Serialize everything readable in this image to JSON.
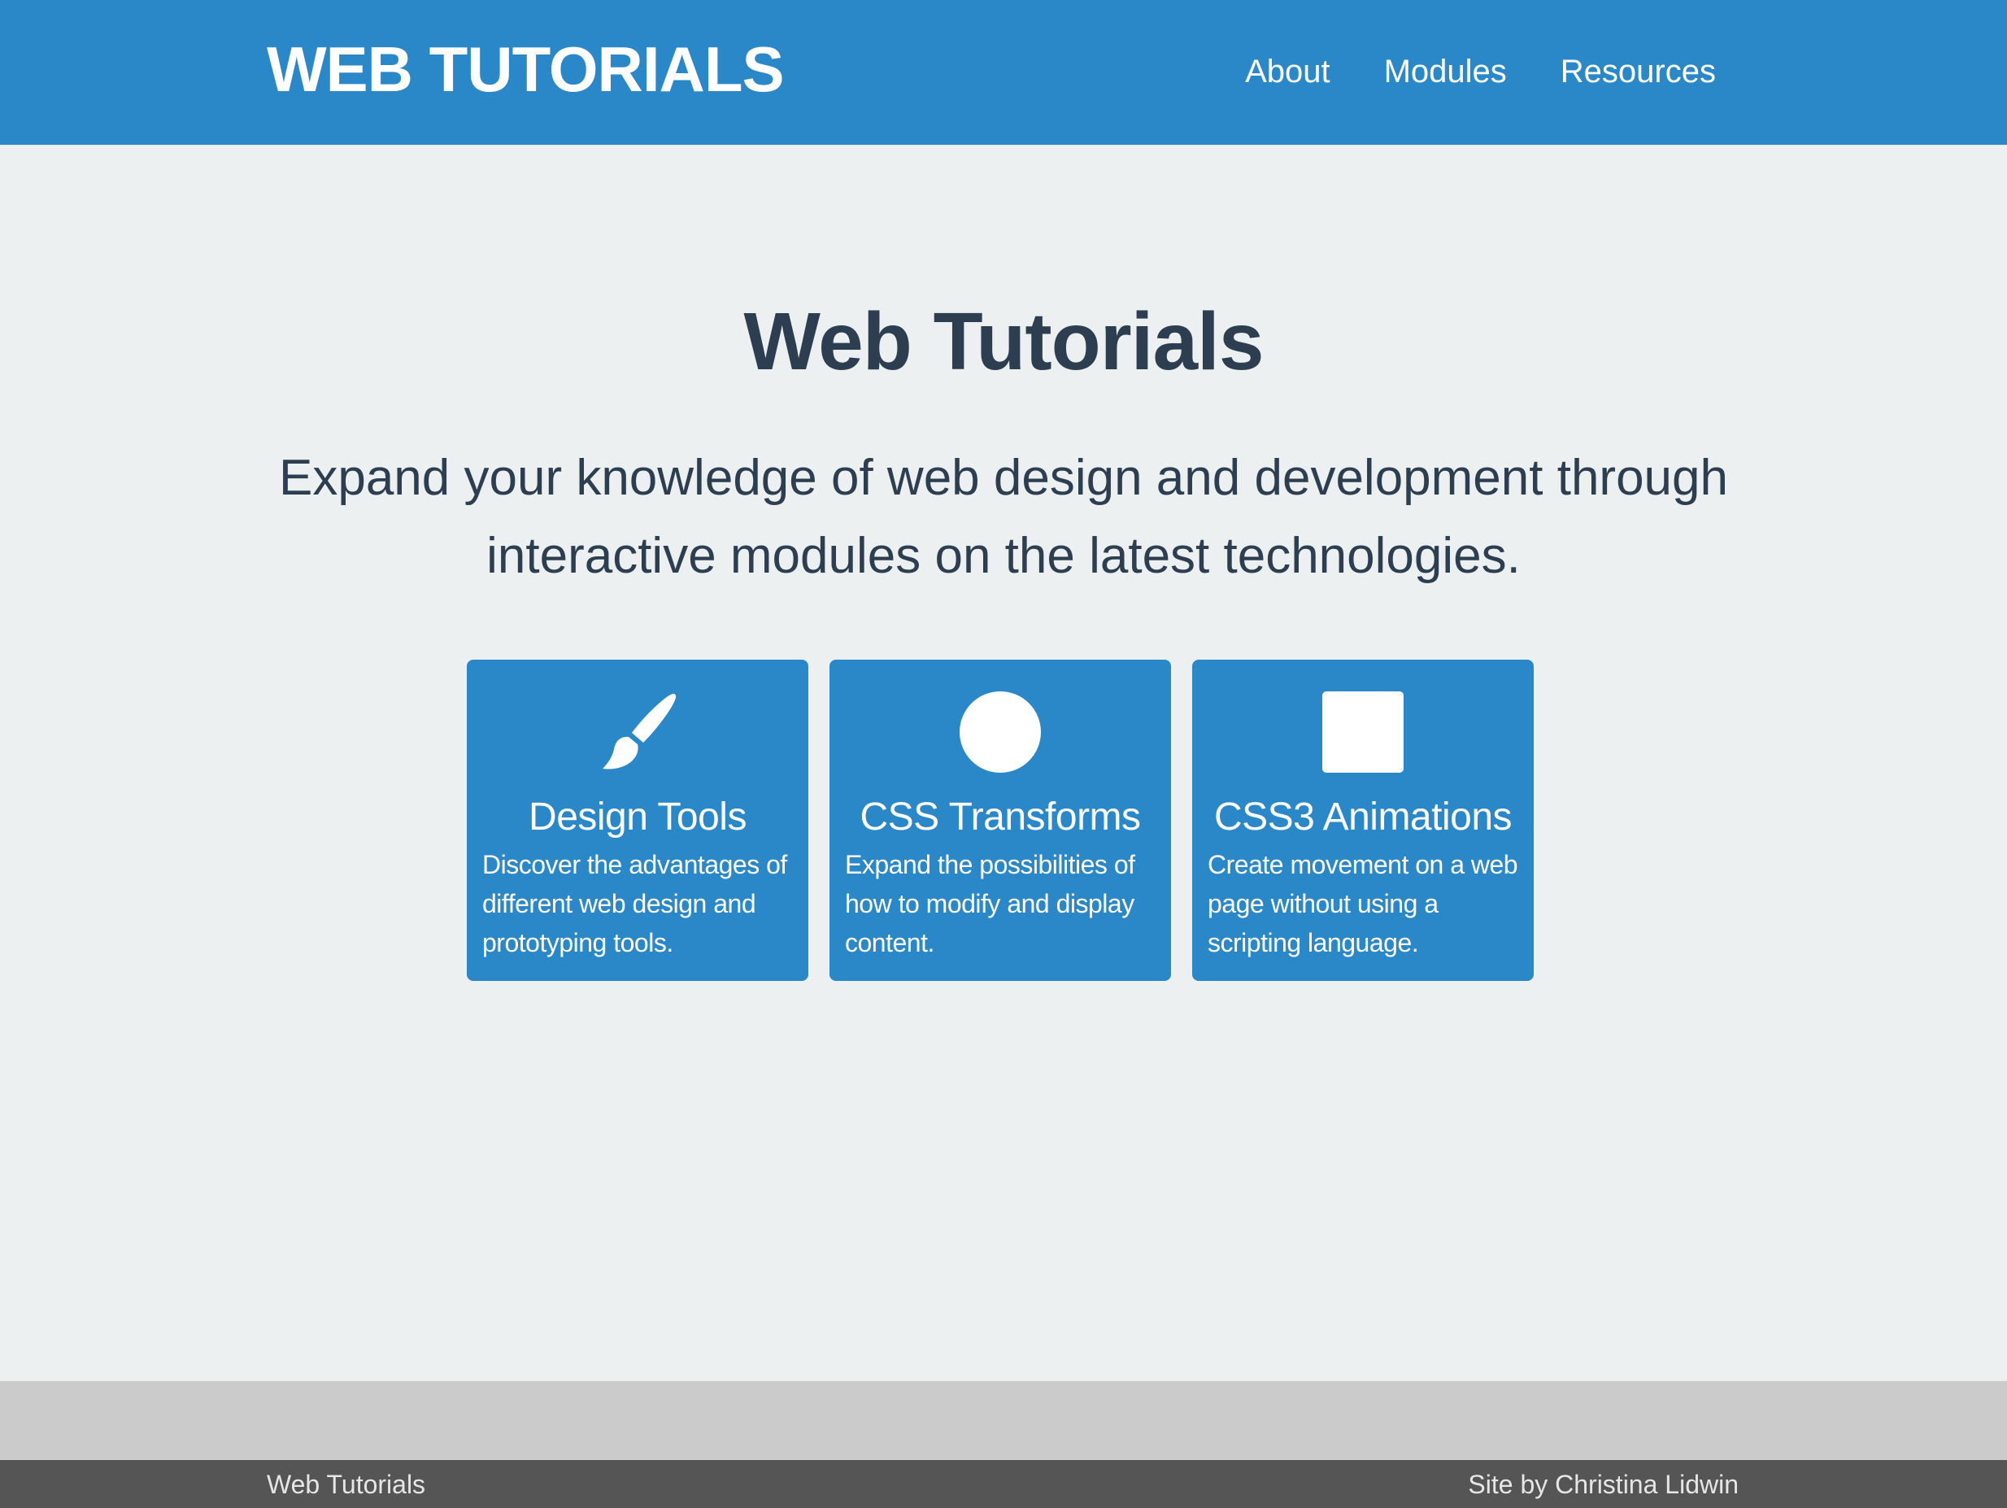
{
  "header": {
    "site_title": "WEB TUTORIALS",
    "nav": [
      {
        "label": "About"
      },
      {
        "label": "Modules"
      },
      {
        "label": "Resources"
      }
    ]
  },
  "hero": {
    "title": "Web Tutorials",
    "subtitle": "Expand your knowledge of web design and development through interactive modules on the latest technologies."
  },
  "cards": [
    {
      "icon": "paintbrush-icon",
      "title": "Design Tools",
      "description": "Discover the advantages of different web design and prototyping tools."
    },
    {
      "icon": "circle-icon",
      "title": "CSS Transforms",
      "description": "Expand the possibilities of how to modify and display content."
    },
    {
      "icon": "square-icon",
      "title": "CSS3 Animations",
      "description": "Create movement on a web page without using a scripting language."
    }
  ],
  "footer": {
    "left": "Web Tutorials",
    "right": "Site by Christina Lidwin"
  },
  "colors": {
    "primary": "#2a88c8",
    "background": "#ecf0f1",
    "heading": "#2c3e50",
    "footer_band": "#cbcbcb",
    "footer": "#555555"
  }
}
